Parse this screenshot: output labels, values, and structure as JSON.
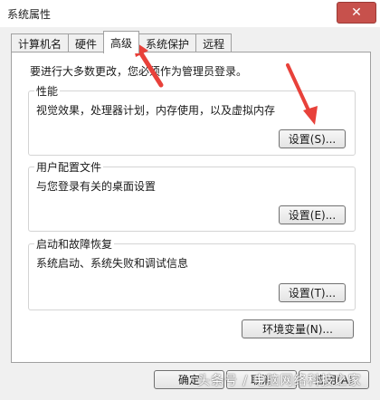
{
  "window": {
    "title": "系统属性",
    "close_symbol": "✕"
  },
  "tabs": [
    {
      "label": "计算机名",
      "active": false
    },
    {
      "label": "硬件",
      "active": false
    },
    {
      "label": "高级",
      "active": true
    },
    {
      "label": "系统保护",
      "active": false
    },
    {
      "label": "远程",
      "active": false
    }
  ],
  "admin_note": "要进行大多数更改，您必须作为管理员登录。",
  "groups": {
    "performance": {
      "label": "性能",
      "description": "视觉效果，处理器计划，内存使用，以及虚拟内存",
      "button": "设置(S)..."
    },
    "user_profiles": {
      "label": "用户配置文件",
      "description": "与您登录有关的桌面设置",
      "button": "设置(E)..."
    },
    "startup": {
      "label": "启动和故障恢复",
      "description": "系统启动、系统失败和调试信息",
      "button": "设置(T)..."
    }
  },
  "env_button": "环境变量(N)...",
  "footer": {
    "ok": "确定",
    "cancel": "取消",
    "apply": "应用(A)"
  },
  "watermark": "头条号 / 电脑网络科技之家",
  "colors": {
    "arrow": "#e8413a",
    "close_button": "#c7514c"
  }
}
